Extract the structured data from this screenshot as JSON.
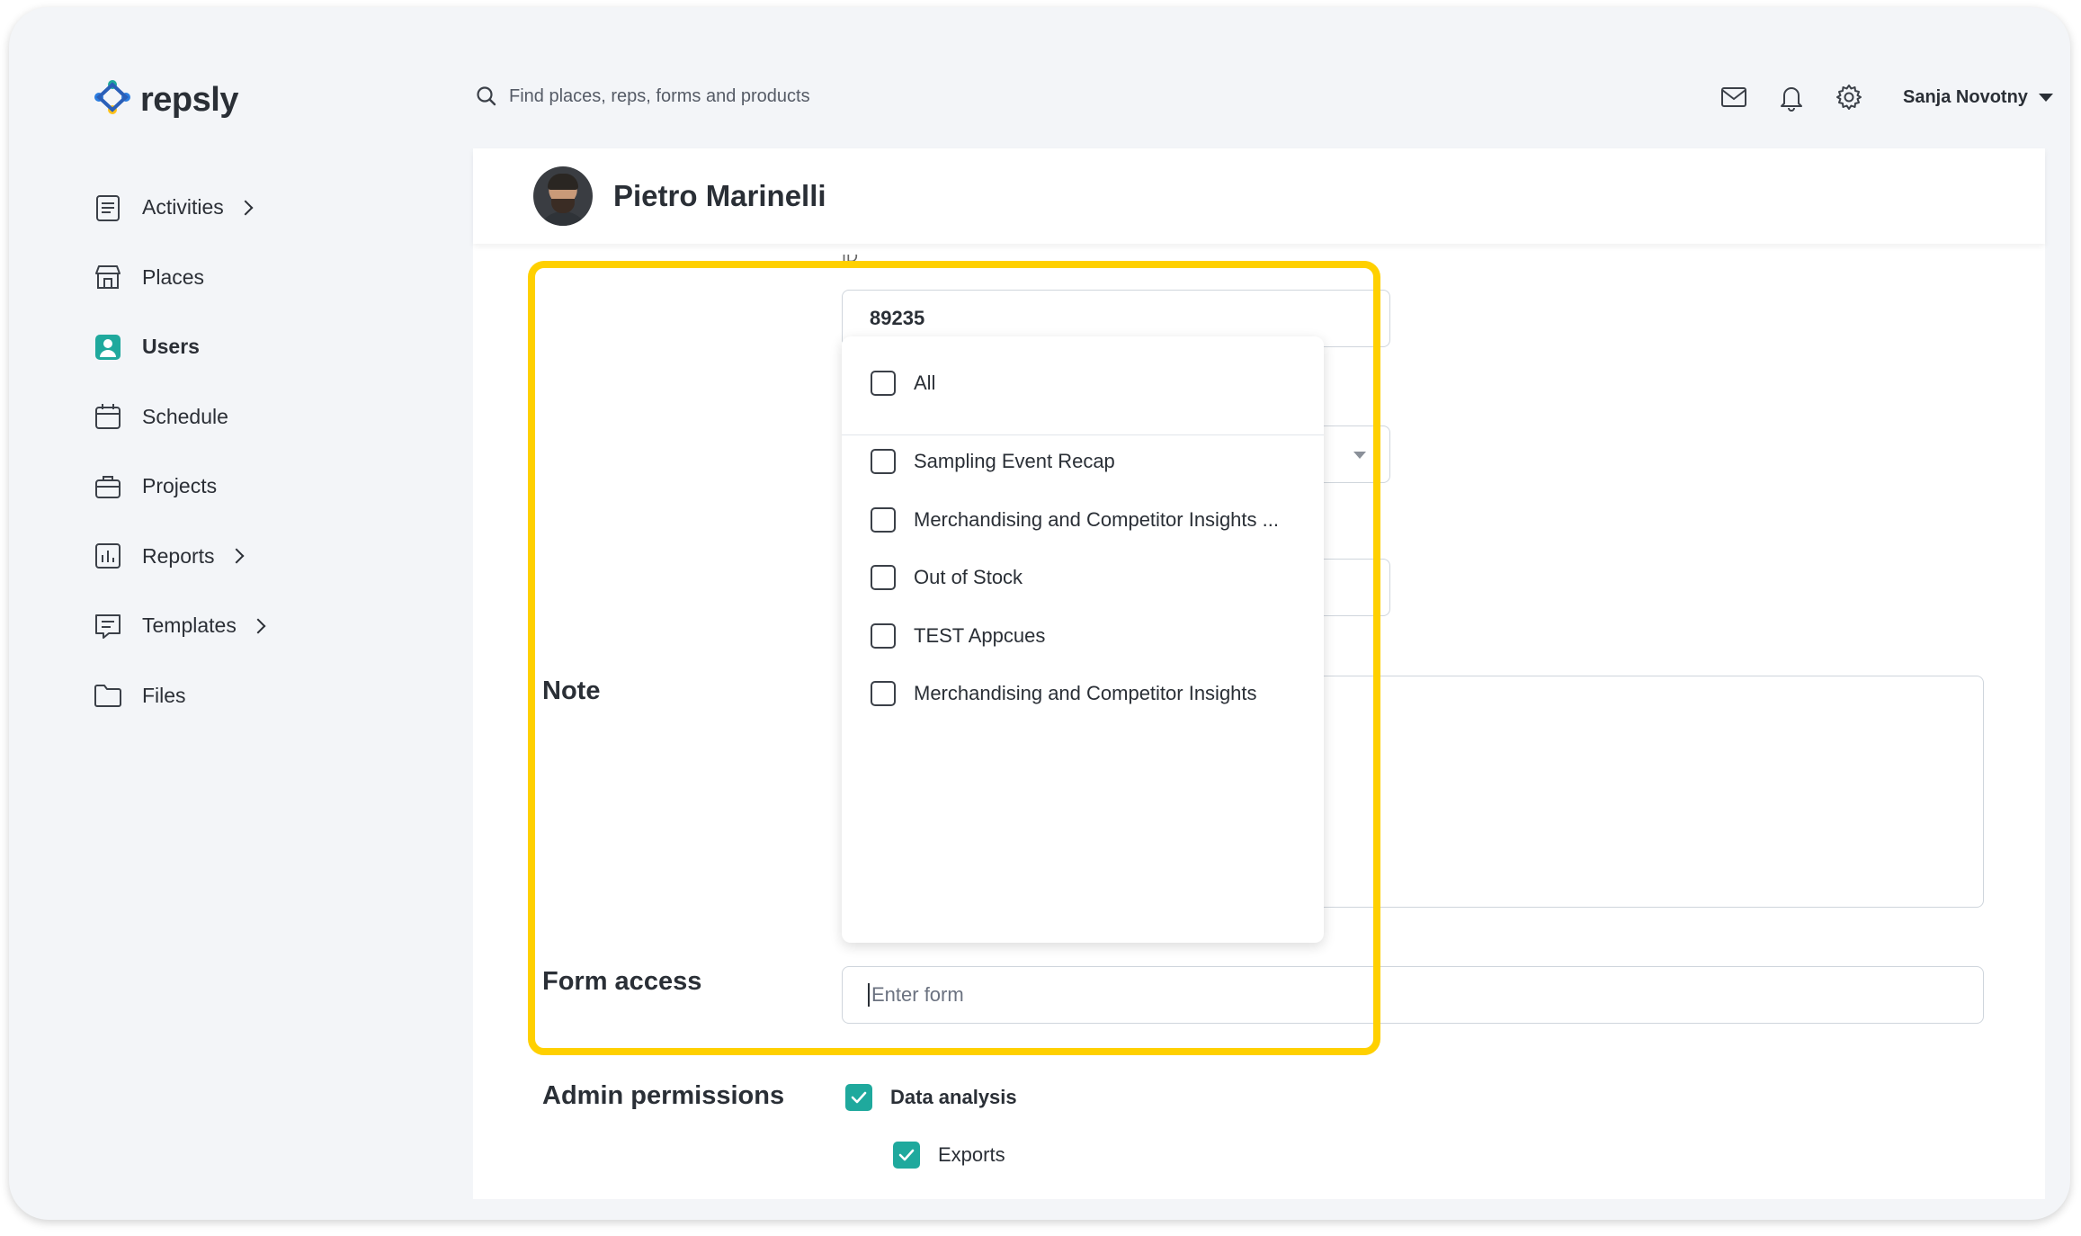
{
  "app": {
    "brand": "repsly",
    "accent_color": "#1fa99d",
    "highlight_color": "#ffd000"
  },
  "search": {
    "placeholder": "Find places, reps, forms and products",
    "icon": "search-icon"
  },
  "topbar": {
    "icons": [
      "mail-icon",
      "bell-icon",
      "gear-icon"
    ],
    "user_name": "Sanja Novotny"
  },
  "sidebar": {
    "items": [
      {
        "label": "Activities",
        "icon": "activities-icon",
        "has_submenu": true
      },
      {
        "label": "Places",
        "icon": "store-icon",
        "has_submenu": false
      },
      {
        "label": "Users",
        "icon": "user-icon",
        "has_submenu": false,
        "active": true
      },
      {
        "label": "Schedule",
        "icon": "calendar-icon",
        "has_submenu": false
      },
      {
        "label": "Projects",
        "icon": "briefcase-icon",
        "has_submenu": false
      },
      {
        "label": "Reports",
        "icon": "chart-icon",
        "has_submenu": true
      },
      {
        "label": "Templates",
        "icon": "template-icon",
        "has_submenu": true
      },
      {
        "label": "Files",
        "icon": "folder-icon",
        "has_submenu": false
      }
    ]
  },
  "profile": {
    "name": "Pietro Marinelli"
  },
  "form": {
    "id_label": "ID",
    "id_value": "89235",
    "note_label": "Note",
    "form_access_label": "Form access",
    "form_access_placeholder": "Enter form"
  },
  "dropdown": {
    "all_label": "All",
    "options": [
      "Sampling Event Recap",
      "Merchandising and Competitor Insights ...",
      "Out of Stock",
      "TEST Appcues",
      "Merchandising and Competitor Insights"
    ]
  },
  "admin": {
    "label": "Admin permissions",
    "data_analysis": {
      "label": "Data analysis",
      "checked": true
    },
    "exports": {
      "label": "Exports",
      "checked": true
    }
  }
}
